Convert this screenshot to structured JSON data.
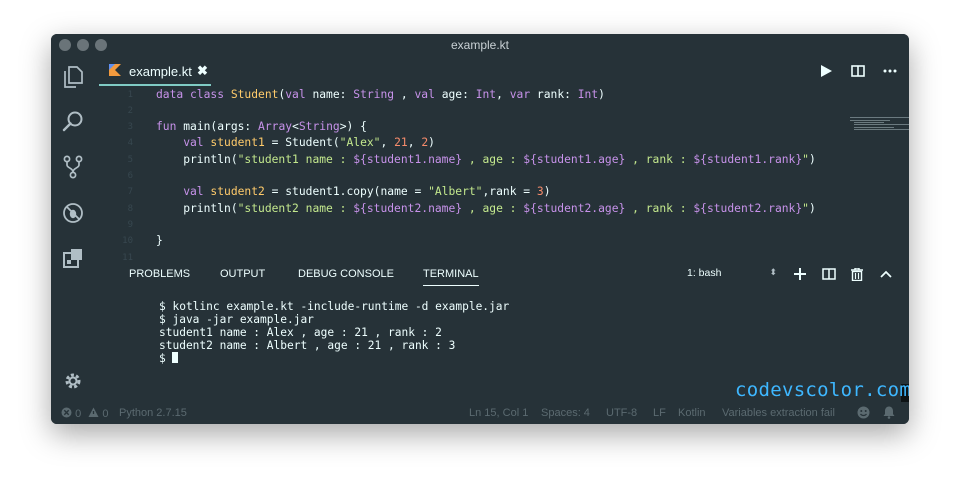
{
  "window": {
    "title": "example.kt"
  },
  "activity_bar": {
    "icons": [
      "files-icon",
      "search-icon",
      "source-control-icon",
      "debug-icon",
      "extensions-icon",
      "settings-icon"
    ]
  },
  "tab": {
    "label": "example.kt",
    "close": "✖"
  },
  "editor": {
    "lines": [
      {
        "num": "1",
        "segments": [
          {
            "t": "data class ",
            "c": "kw"
          },
          {
            "t": "Student",
            "c": "ty"
          },
          {
            "t": "(",
            "c": ""
          },
          {
            "t": "val",
            "c": "kw"
          },
          {
            "t": " name: ",
            "c": ""
          },
          {
            "t": "String",
            "c": "kw"
          },
          {
            "t": " , ",
            "c": ""
          },
          {
            "t": "val",
            "c": "kw"
          },
          {
            "t": " age: ",
            "c": ""
          },
          {
            "t": "Int",
            "c": "kw"
          },
          {
            "t": ", ",
            "c": ""
          },
          {
            "t": "var",
            "c": "kw"
          },
          {
            "t": " rank: ",
            "c": ""
          },
          {
            "t": "Int",
            "c": "kw"
          },
          {
            "t": ")",
            "c": ""
          }
        ]
      },
      {
        "num": "2",
        "segments": []
      },
      {
        "num": "3",
        "segments": [
          {
            "t": "fun ",
            "c": "kw"
          },
          {
            "t": "main(args: ",
            "c": ""
          },
          {
            "t": "Array",
            "c": "kw"
          },
          {
            "t": "<",
            "c": ""
          },
          {
            "t": "String",
            "c": "kw"
          },
          {
            "t": ">) {",
            "c": ""
          }
        ]
      },
      {
        "num": "4",
        "segments": [
          {
            "t": "    val ",
            "c": "kw"
          },
          {
            "t": "student1",
            "c": "ty"
          },
          {
            "t": " = Student(",
            "c": ""
          },
          {
            "t": "\"Alex\"",
            "c": "st"
          },
          {
            "t": ", ",
            "c": ""
          },
          {
            "t": "21",
            "c": "nm"
          },
          {
            "t": ", ",
            "c": ""
          },
          {
            "t": "2",
            "c": "nm"
          },
          {
            "t": ")",
            "c": ""
          }
        ]
      },
      {
        "num": "5",
        "segments": [
          {
            "t": "    println(",
            "c": ""
          },
          {
            "t": "\"student1 name : ",
            "c": "st"
          },
          {
            "t": "${student1.name}",
            "c": "kw"
          },
          {
            "t": " , age : ",
            "c": "st"
          },
          {
            "t": "${student1.age}",
            "c": "kw"
          },
          {
            "t": " , rank : ",
            "c": "st"
          },
          {
            "t": "${student1.rank}",
            "c": "kw"
          },
          {
            "t": "\"",
            "c": "st"
          },
          {
            "t": ")",
            "c": ""
          }
        ]
      },
      {
        "num": "6",
        "segments": []
      },
      {
        "num": "7",
        "segments": [
          {
            "t": "    val ",
            "c": "kw"
          },
          {
            "t": "student2",
            "c": "ty"
          },
          {
            "t": " = student1.copy(name = ",
            "c": ""
          },
          {
            "t": "\"Albert\"",
            "c": "st"
          },
          {
            "t": ",rank = ",
            "c": ""
          },
          {
            "t": "3",
            "c": "nm"
          },
          {
            "t": ")",
            "c": ""
          }
        ]
      },
      {
        "num": "8",
        "segments": [
          {
            "t": "    println(",
            "c": ""
          },
          {
            "t": "\"student2 name : ",
            "c": "st"
          },
          {
            "t": "${student2.name}",
            "c": "kw"
          },
          {
            "t": " , age : ",
            "c": "st"
          },
          {
            "t": "${student2.age}",
            "c": "kw"
          },
          {
            "t": " , rank : ",
            "c": "st"
          },
          {
            "t": "${student2.rank}",
            "c": "kw"
          },
          {
            "t": "\"",
            "c": "st"
          },
          {
            "t": ")",
            "c": ""
          }
        ]
      },
      {
        "num": "9",
        "segments": []
      },
      {
        "num": "10",
        "segments": [
          {
            "t": "}",
            "c": ""
          }
        ]
      },
      {
        "num": "11",
        "segments": []
      }
    ]
  },
  "panel": {
    "tabs": [
      "PROBLEMS",
      "OUTPUT",
      "DEBUG CONSOLE",
      "TERMINAL"
    ],
    "active_tab": "TERMINAL",
    "terminal_select": "1: bash",
    "terminal_lines": [
      "$ kotlinc example.kt -include-runtime -d example.jar",
      "$ java -jar example.jar",
      "student1 name : Alex , age : 21 , rank : 2",
      "student2 name : Albert , age : 21 , rank : 3",
      "$ "
    ]
  },
  "watermark": "codevscolor.com",
  "status": {
    "errors": "0",
    "warnings": "0",
    "python": "Python 2.7.15",
    "position": "Ln 15, Col 1",
    "spaces": "Spaces: 4",
    "encoding": "UTF-8",
    "eol": "LF",
    "language": "Kotlin",
    "message": "Variables extraction fail"
  }
}
